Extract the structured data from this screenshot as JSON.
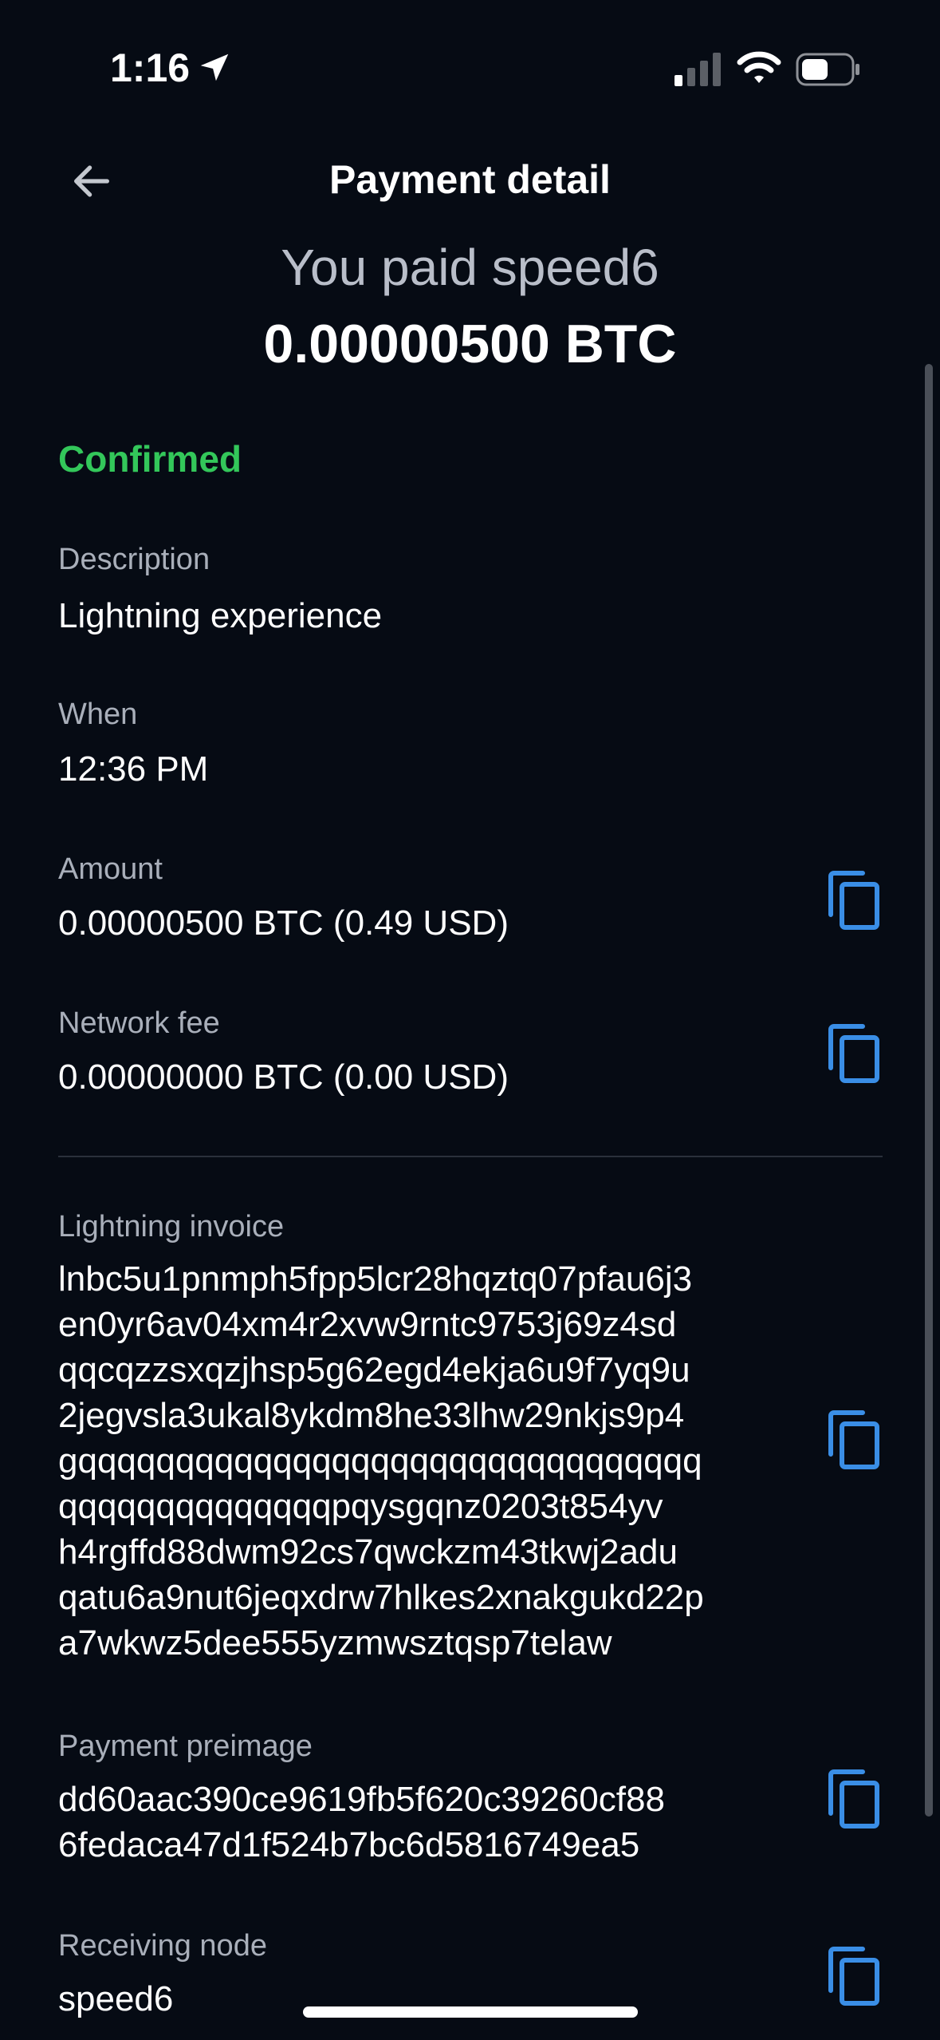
{
  "status_bar": {
    "time": "1:16"
  },
  "header": {
    "title": "Payment detail",
    "paid_to": "You paid speed6",
    "amount": "0.00000500 BTC"
  },
  "payment": {
    "status": "Confirmed",
    "description_label": "Description",
    "description_value": "Lightning experience",
    "when_label": "When",
    "when_value": "12:36 PM",
    "amount_label": "Amount",
    "amount_value": "0.00000500 BTC (0.49 USD)",
    "fee_label": "Network fee",
    "fee_value": "0.00000000 BTC (0.00 USD)",
    "invoice_label": "Lightning invoice",
    "invoice_lines": [
      "lnbc5u1pnmph5fpp5lcr28hqztq07pfau6j3",
      "en0yr6av04xm4r2xvw9rntc9753j69z4sd",
      "qqcqzzsxqzjhsp5g62egd4ekja6u9f7yq9u",
      "2jegvsla3ukal8ykdm8he33lhw29nkjs9p4",
      "gqqqqqqqqqqqqqqqqqqqqqqqqqqqqqqqq",
      "qqqqqqqqqqqqqqpqysgqnz0203t854yv",
      "h4rgffd88dwm92cs7qwckzm43tkwj2adu",
      "qatu6a9nut6jeqxdrw7hlkes2xnakgukd22p",
      "a7wkwz5dee555yzmwsztqsp7telaw"
    ],
    "preimage_label": "Payment preimage",
    "preimage_lines": [
      "dd60aac390ce9619fb5f620c39260cf88",
      "6fedaca47d1f524b7bc6d5816749ea5"
    ],
    "node_label": "Receiving node",
    "node_value": "speed6"
  },
  "icons": {
    "back": "arrow-left-icon",
    "copy": "copy-icon",
    "location": "location-arrow-icon",
    "signal": "cellular-signal-icon",
    "wifi": "wifi-icon",
    "battery": "battery-icon"
  },
  "colors": {
    "background": "#060b14",
    "confirmed": "#33c75a",
    "accent": "#3a8ee6",
    "label": "#a9afba"
  }
}
